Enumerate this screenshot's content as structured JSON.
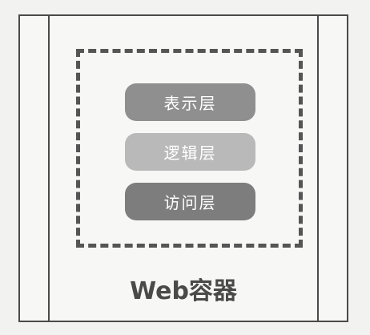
{
  "diagram": {
    "container_label": "Web容器",
    "layers": [
      {
        "label": "表示层",
        "color": "#8f8f8f"
      },
      {
        "label": "逻辑层",
        "color": "#b9b9b9"
      },
      {
        "label": "访问层",
        "color": "#7d7d7d"
      }
    ],
    "colors": {
      "border": "#4a4a4a",
      "dashed": "#555555",
      "text_on_layer": "#ffffff"
    }
  }
}
